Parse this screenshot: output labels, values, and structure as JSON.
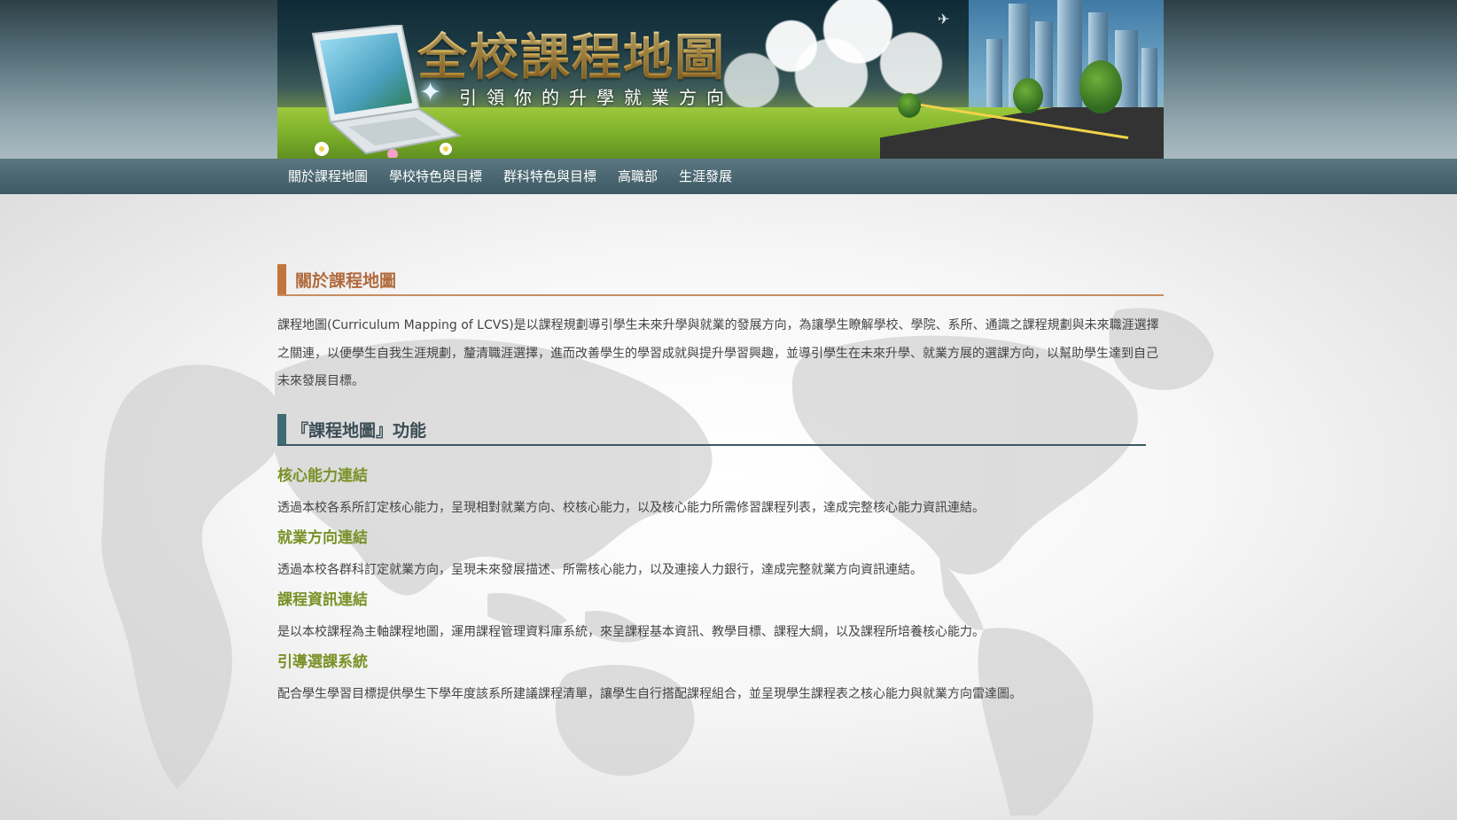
{
  "colors": {
    "nav_bg": "#4a6670",
    "section_accent": "#c3753e",
    "section_title": "#b06a3c",
    "function_accent": "#3d6c72",
    "feature_title": "#7a9126",
    "body_text": "#444444"
  },
  "banner": {
    "title": "全校課程地圖",
    "subtitle": "引領你的升學就業方向"
  },
  "nav": {
    "items": [
      {
        "label": "關於課程地圖"
      },
      {
        "label": "學校特色與目標"
      },
      {
        "label": "群科特色與目標"
      },
      {
        "label": "高職部"
      },
      {
        "label": "生涯發展"
      }
    ]
  },
  "about": {
    "title": "關於課程地圖",
    "body": "課程地圖(Curriculum Mapping of LCVS)是以課程規劃導引學生未來升學與就業的發展方向，為讓學生瞭解學校、學院、系所、通識之課程規劃與未來職涯選擇之關連，以便學生自我生涯規劃，釐清職涯選擇，進而改善學生的學習成就與提升學習興趣，並導引學生在未來升學、就業方展的選課方向，以幫助學生達到自己未來發展目標。"
  },
  "functions": {
    "title": "『課程地圖』功能",
    "items": [
      {
        "title": "核心能力連結",
        "desc": "透過本校各系所訂定核心能力，呈現相對就業方向、校核心能力，以及核心能力所需修習課程列表，達成完整核心能力資訊連結。"
      },
      {
        "title": "就業方向連結",
        "desc": "透過本校各群科訂定就業方向，呈現未來發展描述、所需核心能力，以及連接人力銀行，達成完整就業方向資訊連結。"
      },
      {
        "title": "課程資訊連結",
        "desc": "是以本校課程為主軸課程地圖，運用課程管理資料庫系統，來呈課程基本資訊、教學目標、課程大綱，以及課程所培養核心能力。"
      },
      {
        "title": "引導選課系統",
        "desc": "配合學生學習目標提供學生下學年度該系所建議課程清單，讓學生自行搭配課程組合，並呈現學生課程表之核心能力與就業方向雷達圖。"
      }
    ]
  }
}
